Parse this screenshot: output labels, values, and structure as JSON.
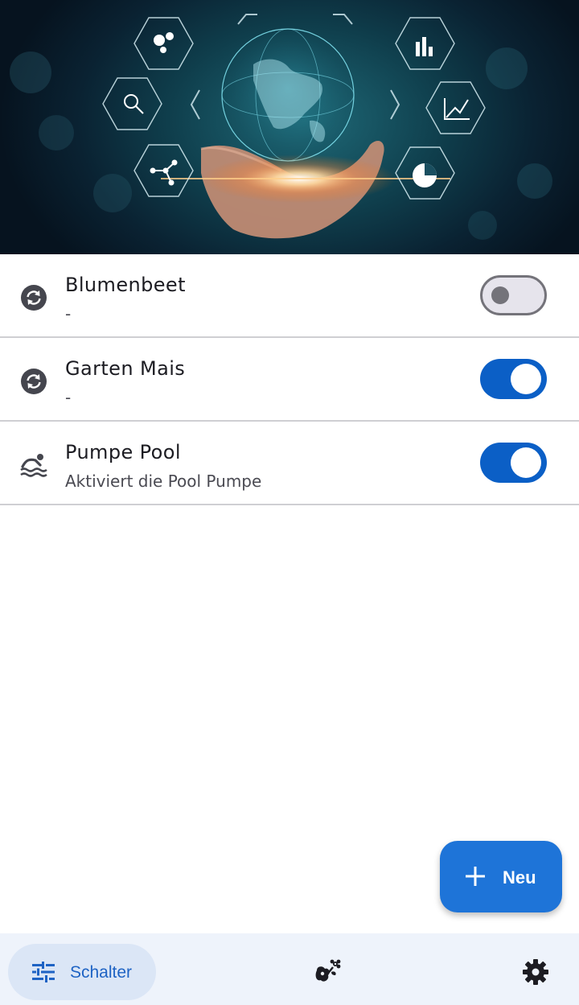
{
  "header": {
    "image": "globe-in-hand-technology-image"
  },
  "switches": [
    {
      "title": "Blumenbeet",
      "subtitle": "-",
      "icon": "sync-icon",
      "enabled": false
    },
    {
      "title": "Garten Mais",
      "subtitle": "-",
      "icon": "sync-icon",
      "enabled": true
    },
    {
      "title": "Pumpe Pool",
      "subtitle": "Aktiviert die Pool Pumpe",
      "icon": "swimming-icon",
      "enabled": true
    }
  ],
  "fab": {
    "label": "Neu",
    "icon": "plus-icon"
  },
  "nav": {
    "items": [
      {
        "label": "Schalter",
        "icon": "tune-icon",
        "active": true
      },
      {
        "label": "",
        "icon": "plant-icon",
        "active": false
      },
      {
        "label": "",
        "icon": "gear-icon",
        "active": false
      }
    ]
  },
  "colors": {
    "accent": "#0b5fc6",
    "fab": "#1e74d8",
    "nav_bg": "#eef3fb",
    "nav_active": "#dbe6f6"
  }
}
